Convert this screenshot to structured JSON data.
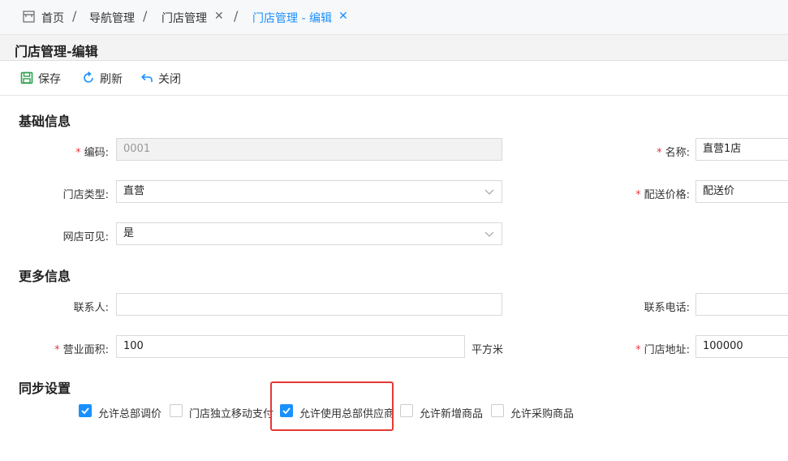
{
  "tabs": [
    {
      "label": "首页"
    },
    {
      "label": "导航管理"
    },
    {
      "label": "门店管理",
      "closable": true
    },
    {
      "label": "门店管理 - 编辑",
      "closable": true,
      "active": true
    }
  ],
  "page_title": "门店管理-编辑",
  "toolbar": {
    "save": "保存",
    "refresh": "刷新",
    "close": "关闭"
  },
  "sections": {
    "basic": "基础信息",
    "more": "更多信息",
    "sync": "同步设置"
  },
  "form": {
    "code": {
      "label": "编码:",
      "value": "0001",
      "required": true
    },
    "name": {
      "label": "名称:",
      "value": "直营1店",
      "required": true
    },
    "store_type": {
      "label": "门店类型:",
      "value": "直营"
    },
    "delivery_price": {
      "label": "配送价格:",
      "value": "配送价",
      "required": true
    },
    "online_visible": {
      "label": "网店可见:",
      "value": "是"
    },
    "contact": {
      "label": "联系人:",
      "value": ""
    },
    "phone": {
      "label": "联系电话:",
      "value": ""
    },
    "area": {
      "label": "营业面积:",
      "value": "100",
      "unit": "平方米",
      "required": true
    },
    "address": {
      "label": "门店地址:",
      "value": "100000",
      "required": true
    }
  },
  "sync": [
    {
      "label": "允许总部调价",
      "checked": true
    },
    {
      "label": "门店独立移动支付",
      "checked": false
    },
    {
      "label": "允许使用总部供应商",
      "checked": true
    },
    {
      "label": "允许新增商品",
      "checked": false
    },
    {
      "label": "允许采购商品",
      "checked": false
    }
  ],
  "colors": {
    "accent": "#1890ff",
    "required": "#e4393c",
    "highlight": "#e53935",
    "save_icon": "#2e9e4f"
  }
}
